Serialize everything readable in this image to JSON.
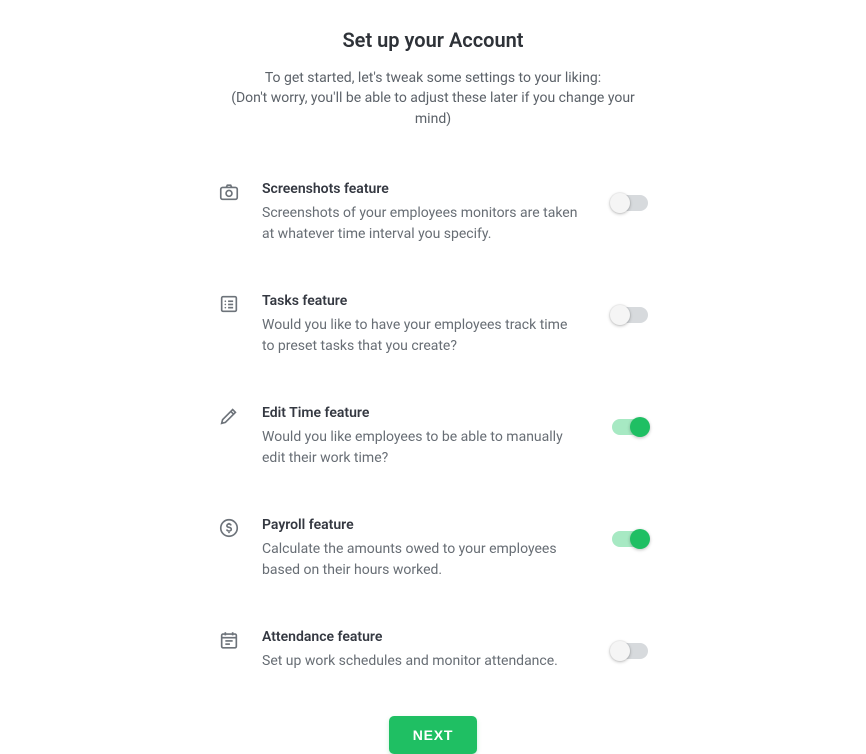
{
  "header": {
    "title": "Set up your Account",
    "subtitle": "To get started, let's tweak some settings to your liking:\n(Don't worry, you'll be able to adjust these later if you change your mind)"
  },
  "features": [
    {
      "icon": "camera-icon",
      "title": "Screenshots feature",
      "desc": "Screenshots of your employees monitors are taken at whatever time interval you specify.",
      "on": false
    },
    {
      "icon": "list-icon",
      "title": "Tasks feature",
      "desc": "Would you like to have your employees track time to preset tasks that you create?",
      "on": false
    },
    {
      "icon": "pencil-icon",
      "title": "Edit Time feature",
      "desc": "Would you like employees to be able to manually edit their work time?",
      "on": true
    },
    {
      "icon": "dollar-icon",
      "title": "Payroll feature",
      "desc": "Calculate the amounts owed to your employees based on their hours worked.",
      "on": true
    },
    {
      "icon": "calendar-icon",
      "title": "Attendance feature",
      "desc": "Set up work schedules and monitor attendance.",
      "on": false
    }
  ],
  "actions": {
    "next_label": "NEXT"
  },
  "colors": {
    "accent": "#1fbf63",
    "toggle_off_track": "#d7dadd",
    "toggle_on_track": "#a7e9c3"
  }
}
